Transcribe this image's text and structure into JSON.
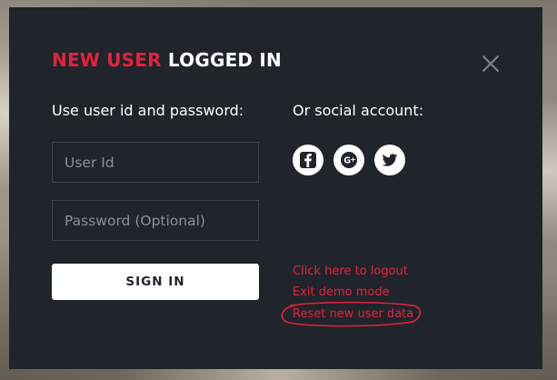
{
  "modal": {
    "title_accent": "NEW USER",
    "title_rest": "LOGGED IN",
    "credentials_label": "Use user id and password:",
    "social_label": "Or social account:",
    "user_id_placeholder": "User Id",
    "password_placeholder": "Password (Optional)",
    "signin_label": "SIGN IN",
    "social_icons": [
      "facebook-icon",
      "google-plus-icon",
      "twitter-icon"
    ],
    "links": {
      "logout": "Click here to logout",
      "exit_demo": "Exit demo mode",
      "reset": "Reset new user data"
    }
  },
  "colors": {
    "modal_bg": "#1f252a",
    "accent": "#e3223e",
    "text": "#ffffff"
  }
}
